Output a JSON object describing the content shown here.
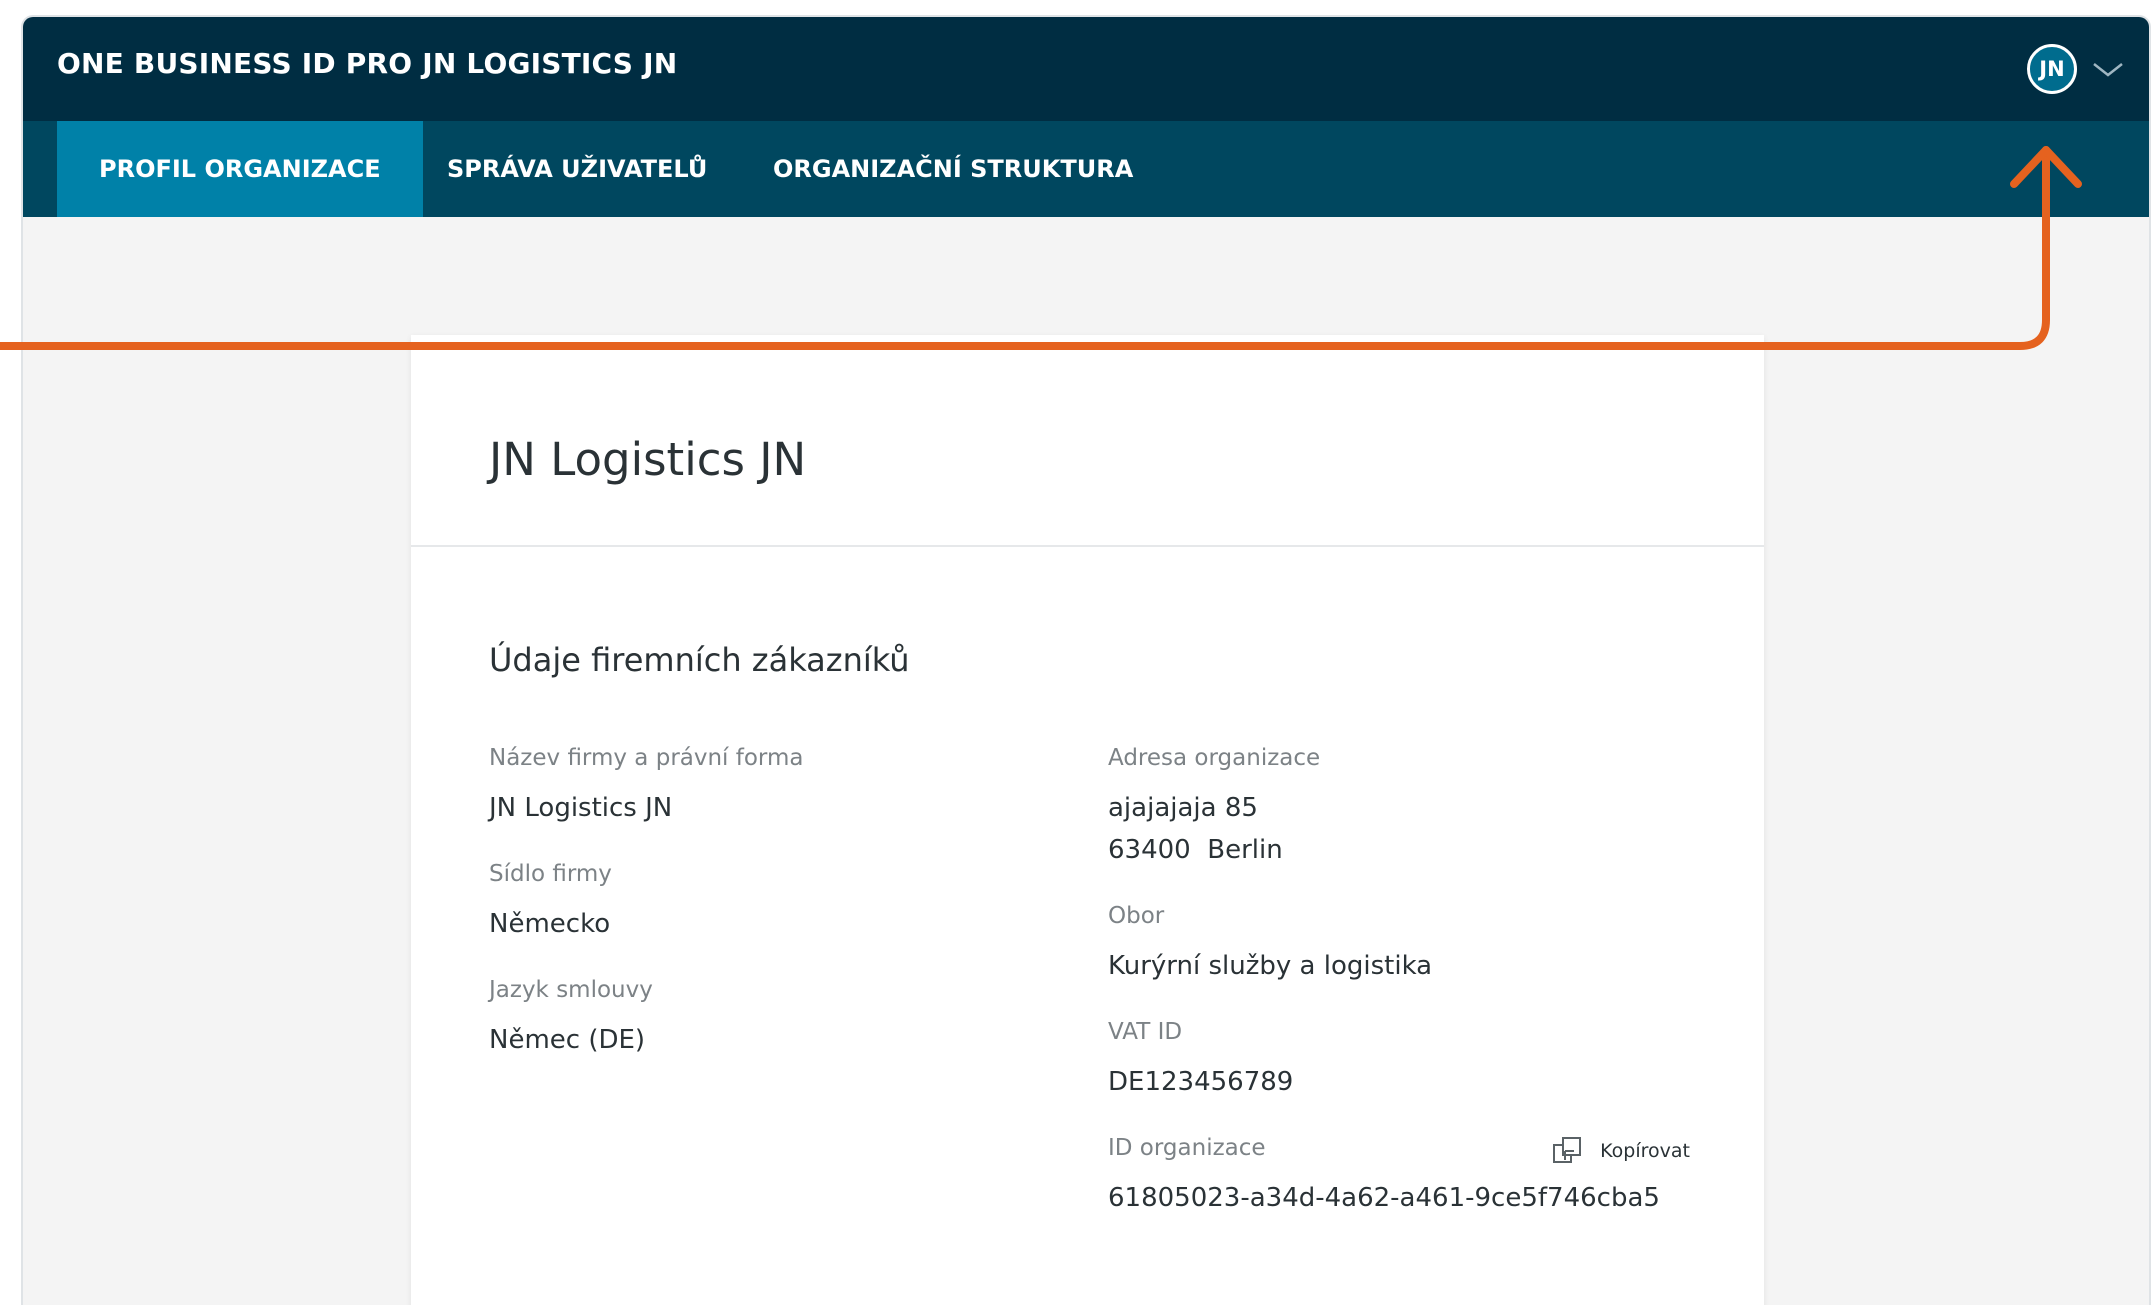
{
  "header": {
    "app_title": "ONE BUSINESS ID PRO JN LOGISTICS JN",
    "user_initials": "JN"
  },
  "tabs": [
    {
      "label": "PROFIL ORGANIZACE",
      "active": true
    },
    {
      "label": "SPRÁVA UŽIVATELŮ",
      "active": false
    },
    {
      "label": "ORGANIZAČNÍ STRUKTURA",
      "active": false
    }
  ],
  "card": {
    "org_name": "JN Logistics JN",
    "section_title": "Údaje firemních zákazníků",
    "left_fields": [
      {
        "label": "Název firmy a právní forma",
        "value": "JN Logistics JN"
      },
      {
        "label": "Sídlo firmy",
        "value": "Německo"
      },
      {
        "label": "Jazyk smlouvy",
        "value": "Němec (DE)"
      }
    ],
    "right_fields": {
      "address": {
        "label": "Adresa organizace",
        "line1": "ajajajaja 85",
        "line2": "63400  Berlin"
      },
      "industry": {
        "label": "Obor",
        "value": "Kurýrní služby a logistika"
      },
      "vat": {
        "label": "VAT ID",
        "value": "DE123456789"
      },
      "org_id": {
        "label": "ID organizace",
        "value": "61805023-a34d-4a62-a461-9ce5f746cba5",
        "copy_label": "Kopírovat"
      }
    }
  },
  "icons": {
    "avatar": "user-avatar",
    "dropdown": "chevron-down-icon",
    "copy": "copy-icon",
    "annotation": "arrow-up-icon"
  },
  "colors": {
    "topbar": "#002d42",
    "tabbar": "#00475f",
    "active_tab": "#0081a8",
    "annotation_arrow": "#e5621f"
  }
}
